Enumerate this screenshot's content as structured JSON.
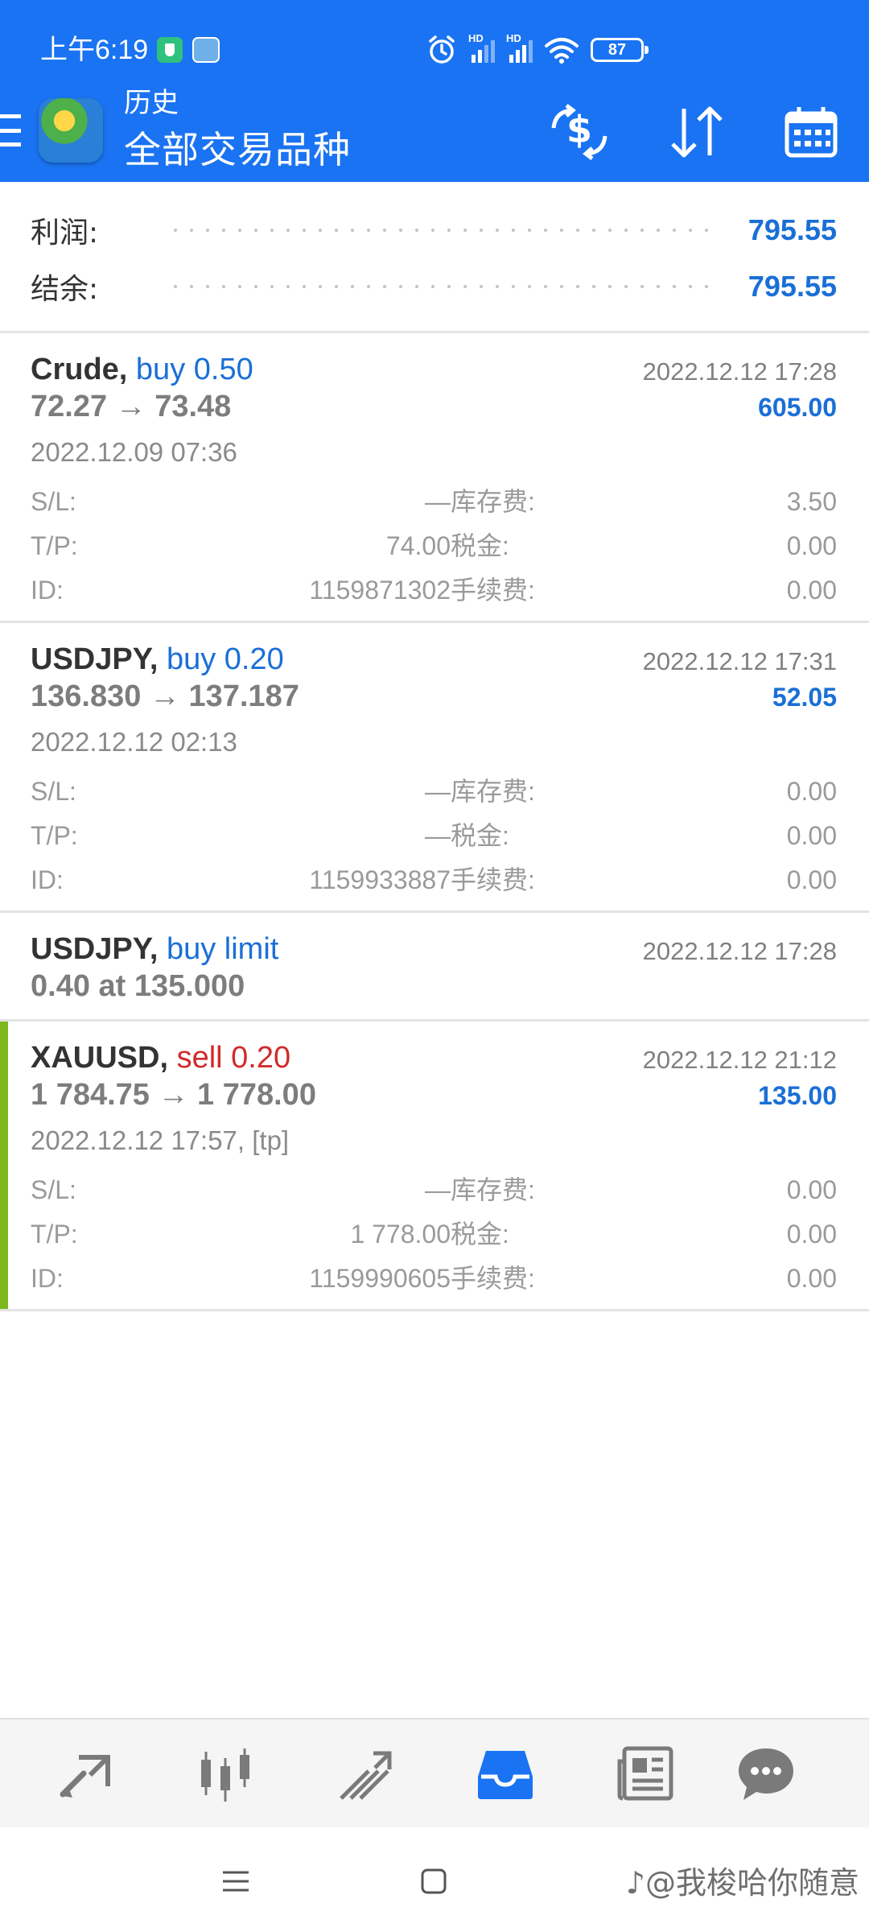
{
  "status_bar": {
    "time": "上午6:19",
    "hd_label_1": "HD",
    "hd_label_2": "HD",
    "battery": "87"
  },
  "toolbar": {
    "title_small": "历史",
    "title_big": "全部交易品种"
  },
  "summary": {
    "profit_label": "利润:",
    "profit_value": "795.55",
    "balance_label": "结余:",
    "balance_value": "795.55"
  },
  "deals": [
    {
      "symbol": "Crude,",
      "type": "buy 0.50",
      "close_time": "2022.12.12 17:28",
      "prices": "72.27 → 73.48",
      "profit": "605.00",
      "open_time": "2022.12.09 07:36",
      "sl_label": "S/L:",
      "sl": "—",
      "swap_label": "库存费:",
      "swap": "3.50",
      "tp_label": "T/P:",
      "tp": "74.00",
      "tax_label": "税金:",
      "tax": "0.00",
      "id_label": "ID:",
      "id": "1159871302",
      "commission_label": "手续费:",
      "commission": "0.00"
    },
    {
      "symbol": "USDJPY,",
      "type": "buy 0.20",
      "close_time": "2022.12.12 17:31",
      "prices": "136.830 → 137.187",
      "profit": "52.05",
      "open_time": "2022.12.12 02:13",
      "sl_label": "S/L:",
      "sl": "—",
      "swap_label": "库存费:",
      "swap": "0.00",
      "tp_label": "T/P:",
      "tp": "—",
      "tax_label": "税金:",
      "tax": "0.00",
      "id_label": "ID:",
      "id": "1159933887",
      "commission_label": "手续费:",
      "commission": "0.00"
    },
    {
      "symbol": "USDJPY,",
      "type": "buy limit",
      "time": "2022.12.12 17:28",
      "detail": "0.40 at 135.000"
    },
    {
      "symbol": "XAUUSD,",
      "type": "sell 0.20",
      "close_time": "2022.12.12 21:12",
      "prices": "1 784.75 → 1 778.00",
      "profit": "135.00",
      "open_time": "2022.12.12 17:57, [tp]",
      "sl_label": "S/L:",
      "sl": "—",
      "swap_label": "库存费:",
      "swap": "0.00",
      "tp_label": "T/P:",
      "tp": "1 778.00",
      "tax_label": "税金:",
      "tax": "0.00",
      "id_label": "ID:",
      "id": "1159990605",
      "commission_label": "手续费:",
      "commission": "0.00"
    }
  ],
  "colors": {
    "header_bg": "#1a73f2",
    "accent_blue": "#1a6fd6",
    "sell_red": "#d12a2a",
    "active_bar": "#7cb81e"
  },
  "icons": {
    "toolbar": [
      "currency-exchange-icon",
      "sort-icon",
      "calendar-icon"
    ],
    "bottom_nav": [
      "quotes-icon",
      "chart-icon",
      "trade-icon",
      "history-icon",
      "news-icon",
      "chat-icon"
    ],
    "system_nav": [
      "menu-icon",
      "home-icon"
    ]
  },
  "watermark": "♪@我梭哈你随意"
}
